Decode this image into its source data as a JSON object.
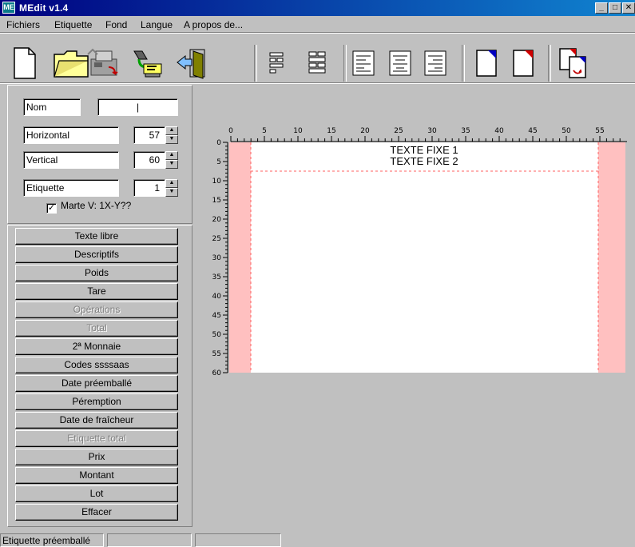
{
  "window": {
    "title": "MEdit v1.4",
    "icon_text": "ME",
    "controls": [
      "_",
      "□",
      "✕"
    ]
  },
  "menu": [
    "Fichiers",
    "Etiquette",
    "Fond",
    "Langue",
    "A propos de..."
  ],
  "toolbar_icons": [
    "new-document-icon",
    "open-folder-icon",
    "scale-transfer-icon",
    "printer-settings-icon",
    "exit-door-icon",
    "layout-grid-1-icon",
    "layout-grid-2-icon",
    "align-left-icon",
    "align-center-icon",
    "align-right-icon",
    "page-corner-blue-icon",
    "page-corner-red-icon",
    "page-swap-icon"
  ],
  "params": {
    "nom": {
      "label": "Nom",
      "value": "|"
    },
    "horizontal": {
      "label": "Horizontal",
      "value": "57"
    },
    "vertical": {
      "label": "Vertical",
      "value": "60"
    },
    "etiquette": {
      "label": "Etiquette",
      "value": "1"
    },
    "checkbox": {
      "label": "Marte V: 1X-Y??",
      "checked": true,
      "mark": "✓"
    }
  },
  "field_buttons": [
    {
      "label": "Texte libre",
      "enabled": true
    },
    {
      "label": "Descriptifs",
      "enabled": true
    },
    {
      "label": "Poids",
      "enabled": true
    },
    {
      "label": "Tare",
      "enabled": true
    },
    {
      "label": "Opérations",
      "enabled": false
    },
    {
      "label": "Total",
      "enabled": false
    },
    {
      "label": "2ª Monnaie",
      "enabled": true
    },
    {
      "label": "Codes ssssaas",
      "enabled": true
    },
    {
      "label": "Date préemballé",
      "enabled": true
    },
    {
      "label": "Péremption",
      "enabled": true
    },
    {
      "label": "Date de fraîcheur",
      "enabled": true
    },
    {
      "label": "Etiquette total",
      "enabled": false
    },
    {
      "label": "Prix",
      "enabled": true
    },
    {
      "label": "Montant",
      "enabled": true
    },
    {
      "label": "Lot",
      "enabled": true
    },
    {
      "label": "Effacer",
      "enabled": true
    }
  ],
  "ruler": {
    "top_labels": [
      "0",
      "5",
      "10",
      "15",
      "20",
      "25",
      "30",
      "35",
      "40",
      "45",
      "50",
      "55"
    ],
    "side_labels": [
      "0",
      "5",
      "10",
      "15",
      "20",
      "25",
      "30",
      "35",
      "40",
      "45",
      "50",
      "55",
      "60"
    ]
  },
  "label_preview": {
    "lines": [
      "TEXTE FIXE 1",
      "TEXTE FIXE 2"
    ],
    "margin_color": "#ffc0c0",
    "guide_color": "#ff6060"
  },
  "status": [
    "Etiquette préemballé",
    "",
    ""
  ]
}
